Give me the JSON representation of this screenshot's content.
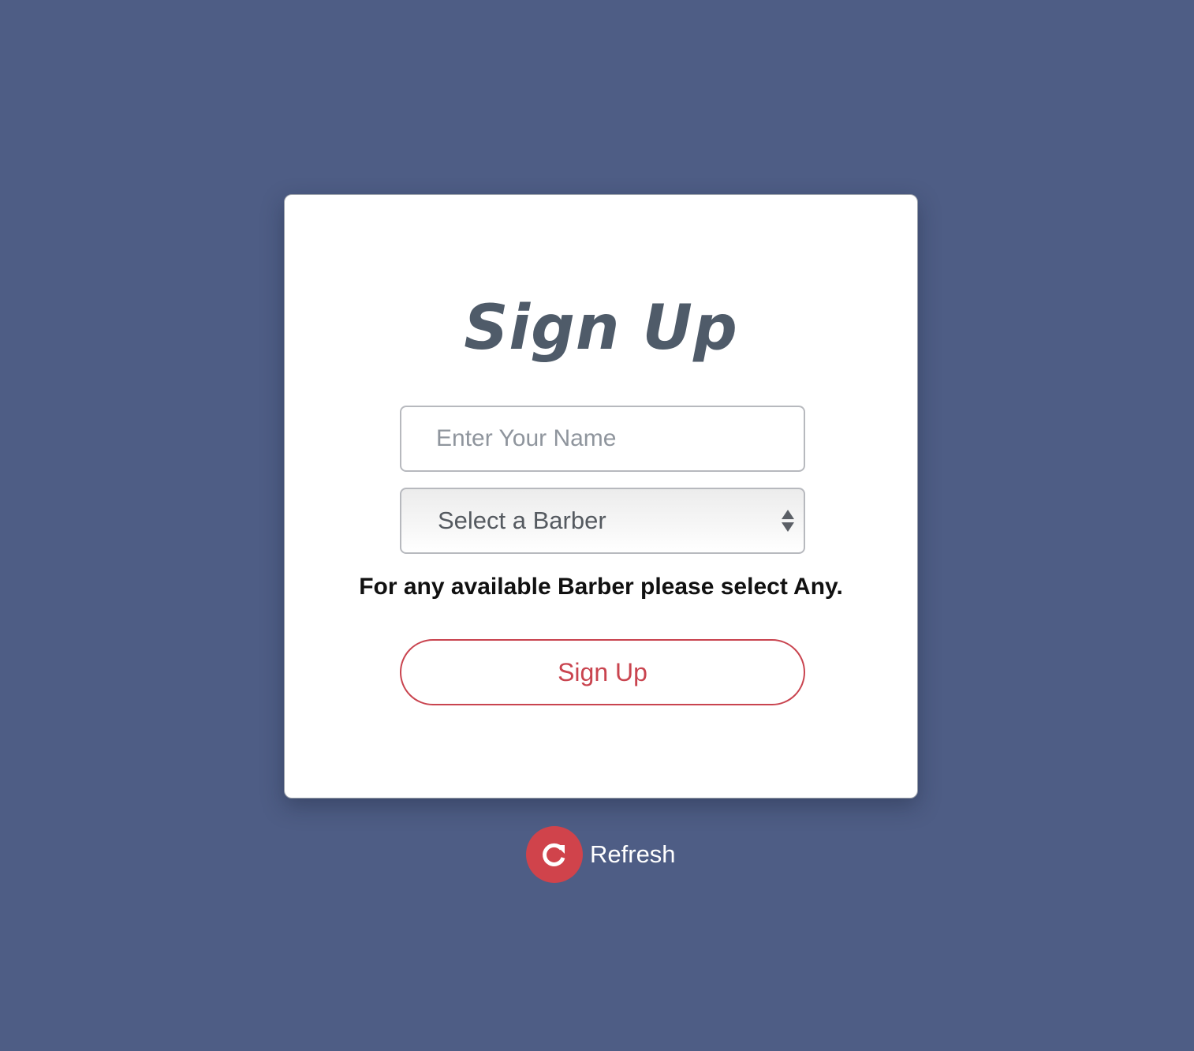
{
  "form": {
    "title": "Sign Up",
    "name_placeholder": "Enter Your Name",
    "barber_select": {
      "selected": "Select a Barber"
    },
    "hint": "For any available Barber please select Any.",
    "submit_label": "Sign Up"
  },
  "refresh": {
    "label": "Refresh",
    "icon": "refresh-icon"
  },
  "colors": {
    "background": "#4e5d85",
    "card": "#ffffff",
    "title": "#4f5b69",
    "accent": "#c9444f",
    "refresh_circle": "#d0434b"
  }
}
